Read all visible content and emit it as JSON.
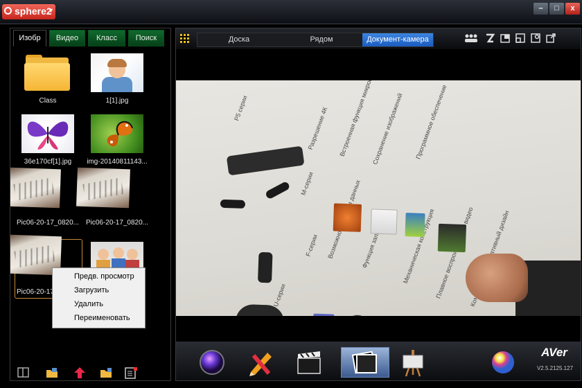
{
  "app": {
    "title": "sphere2"
  },
  "window_controls": {
    "minimize": "–",
    "maximize": "□",
    "close": "x"
  },
  "left_panel": {
    "tabs": [
      "Изобр",
      "Видео",
      "Класс",
      "Поиск"
    ],
    "active_tab": "Изобр",
    "thumbnails": [
      {
        "caption": "Class",
        "kind": "folder"
      },
      {
        "caption": "1[1].jpg",
        "kind": "photo"
      },
      {
        "caption": "36e170cf[1].jpg",
        "kind": "photo"
      },
      {
        "caption": "img-20140811143...",
        "kind": "photo"
      },
      {
        "caption": "Pic06-20-17_0820...",
        "kind": "photo"
      },
      {
        "caption": "Pic06-20-17_0820...",
        "kind": "photo"
      },
      {
        "caption": "Pic06-20-17_",
        "kind": "photo",
        "selected": true
      },
      {
        "caption": "",
        "kind": "photo"
      }
    ],
    "bottom_icons": [
      "split-view-icon",
      "open-folder-image-icon",
      "upload-arrow-icon",
      "new-folder-icon",
      "export-list-icon"
    ]
  },
  "context_menu": {
    "items": [
      "Предв. просмотр",
      "Загрузить",
      "Удалить",
      "Переименовать"
    ]
  },
  "right_panel": {
    "modes": [
      "Доска",
      "Рядом",
      "Документ-камера"
    ],
    "active_mode": "Документ-камера",
    "toolbar_icons": [
      "people-settings-icon",
      "freeze-icon",
      "capture-icon",
      "window-icon",
      "record-icon",
      "export-icon"
    ],
    "camera_labels": [
      "P5 серии",
      "Разрешение 4К",
      "Встроенная функция микрофона",
      "Сохранение изображений",
      "Программное обеспечение",
      "М-серии",
      "F-серии",
      "Возможность записи данных",
      "Функция записи",
      "Механическая конструкция",
      "Плавное воспроизведение видео",
      "Компактный и портативный дизайн",
      "U-серии"
    ],
    "dock": {
      "buttons": [
        "sphere-app-button",
        "annotation-tools-button",
        "video-clip-button",
        "document-camera-button",
        "presentation-button",
        "color-button"
      ],
      "selected": "document-camera-button",
      "brand": "AVer",
      "version": "V2.5.2125.127"
    }
  },
  "colors": {
    "accent_blue": "#1a5cc0",
    "tab_green": "#0f6a2e",
    "logo_red": "#c7241c"
  }
}
